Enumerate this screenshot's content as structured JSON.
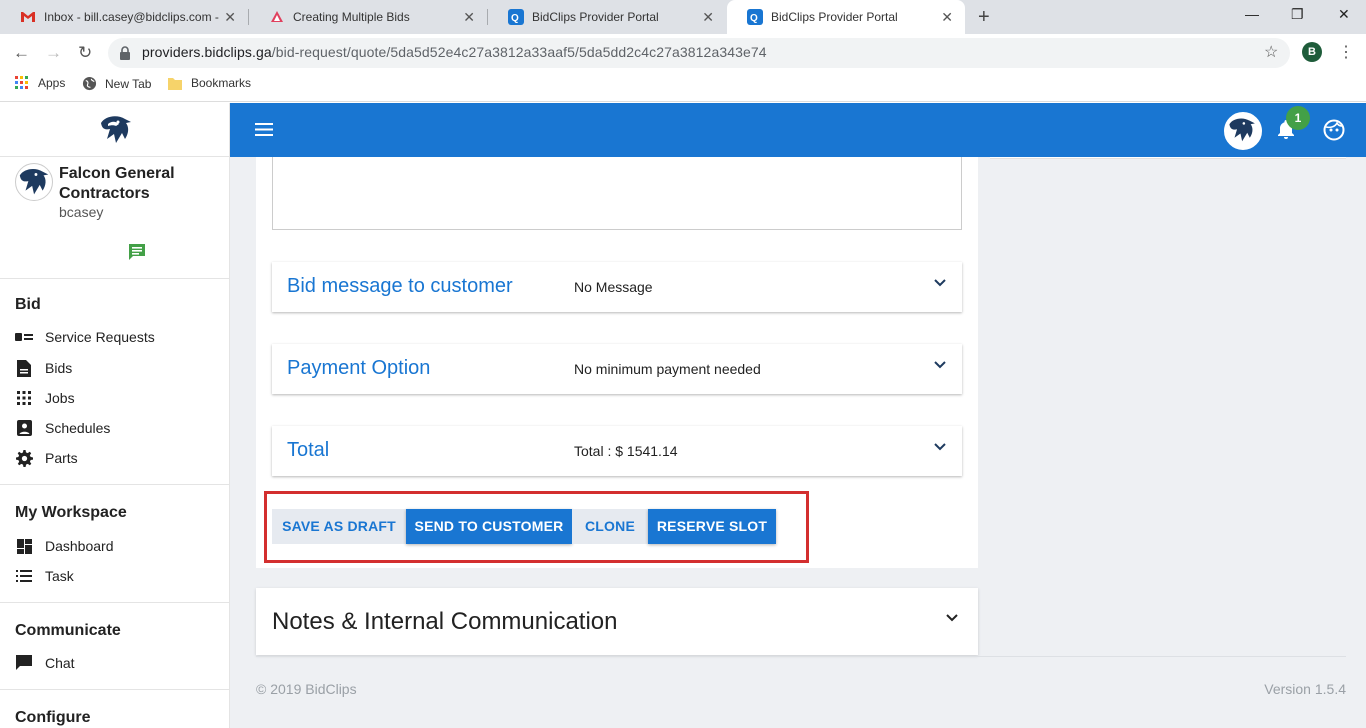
{
  "browser": {
    "tabs": [
      {
        "title": "Inbox - bill.casey@bidclips.com -",
        "icon": "gmail-icon"
      },
      {
        "title": "Creating Multiple Bids",
        "icon": "document-icon"
      },
      {
        "title": "BidClips Provider Portal",
        "icon": "bidclips-icon"
      },
      {
        "title": "BidClips Provider Portal",
        "icon": "bidclips-icon",
        "active": true
      }
    ],
    "url_host": "providers.bidclips.ga",
    "url_path": "/bid-request/quote/5da5d52e4c27a3812a33aaf5/5da5dd2c4c27a3812a343e74",
    "profile_initial": "B",
    "bookmarks": [
      {
        "label": "Apps",
        "icon": "apps-grid-icon"
      },
      {
        "label": "New Tab",
        "icon": "globe-icon"
      },
      {
        "label": "Bookmarks",
        "icon": "folder-icon"
      }
    ]
  },
  "sidebar": {
    "company": "Falcon General Contractors",
    "username": "bcasey",
    "sections": [
      {
        "title": "Bid",
        "items": [
          {
            "label": "Service Requests",
            "icon": "service-requests-icon"
          },
          {
            "label": "Bids",
            "icon": "bids-icon"
          },
          {
            "label": "Jobs",
            "icon": "jobs-icon"
          },
          {
            "label": "Schedules",
            "icon": "schedules-icon"
          },
          {
            "label": "Parts",
            "icon": "parts-gear-icon"
          }
        ]
      },
      {
        "title": "My Workspace",
        "items": [
          {
            "label": "Dashboard",
            "icon": "dashboard-icon"
          },
          {
            "label": "Task",
            "icon": "task-list-icon"
          }
        ]
      },
      {
        "title": "Communicate",
        "items": [
          {
            "label": "Chat",
            "icon": "chat-icon"
          }
        ]
      },
      {
        "title": "Configure",
        "items": []
      }
    ]
  },
  "topbar": {
    "notification_count": "1"
  },
  "bid": {
    "panels": [
      {
        "title": "Bid message to customer",
        "value": "No Message"
      },
      {
        "title": "Payment Option",
        "value": "No minimum payment needed"
      },
      {
        "title": "Total",
        "value": "Total : $ 1541.14"
      }
    ],
    "actions": {
      "save_draft": "SAVE AS DRAFT",
      "send": "SEND TO CUSTOMER",
      "clone": "CLONE",
      "reserve": "RESERVE SLOT"
    },
    "notes_title": "Notes & Internal Communication"
  },
  "footer": {
    "copyright": "© 2019 BidClips",
    "version": "Version 1.5.4"
  },
  "colors": {
    "primary": "#1976d2",
    "highlight_box": "#d32f2f",
    "badge": "#43a047"
  }
}
